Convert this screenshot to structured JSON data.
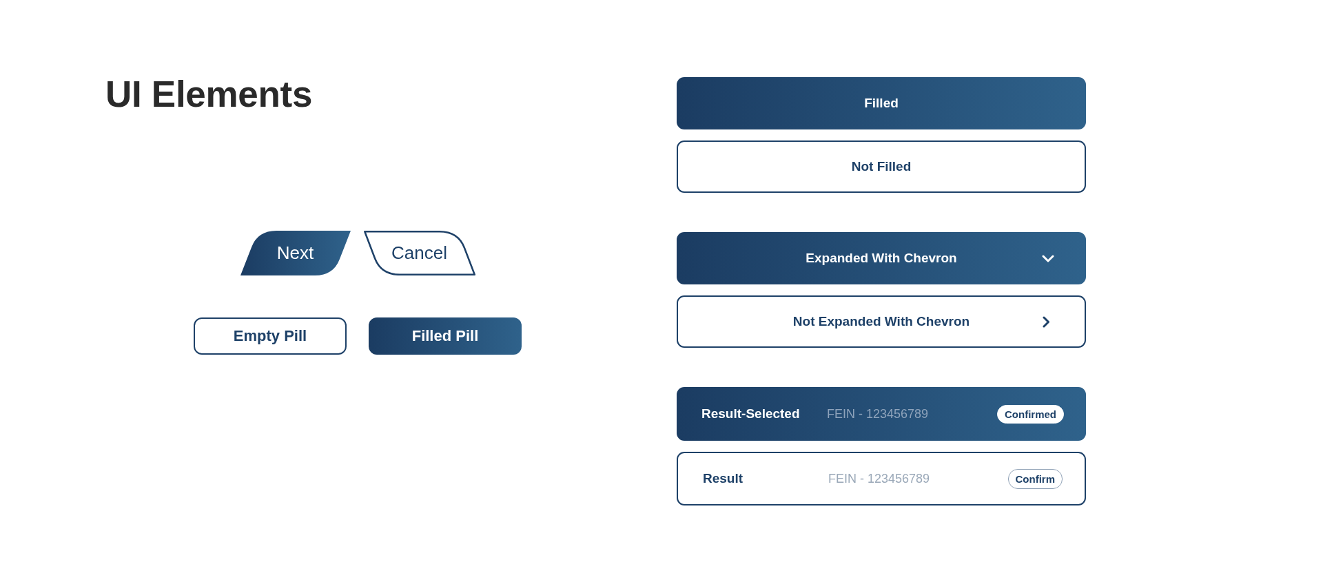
{
  "title": "UI Elements",
  "step_buttons": [
    {
      "label": "Next",
      "kind": "filled"
    },
    {
      "label": "Cancel",
      "kind": "outline"
    }
  ],
  "pills": [
    {
      "label": "Empty Pill",
      "kind": "outline"
    },
    {
      "label": "Filled Pill",
      "kind": "filled"
    }
  ],
  "groups": [
    {
      "items": [
        {
          "kind": "button",
          "label": "Filled",
          "filled": true
        },
        {
          "kind": "button",
          "label": "Not Filled",
          "filled": false
        }
      ]
    },
    {
      "items": [
        {
          "kind": "accordion",
          "label": "Expanded With Chevron",
          "expanded": true
        },
        {
          "kind": "accordion",
          "label": "Not Expanded With Chevron",
          "expanded": false
        }
      ]
    },
    {
      "items": [
        {
          "kind": "result",
          "label": "Result-Selected",
          "detail": "FEIN - 123456789",
          "badge": "Confirmed",
          "selected": true
        },
        {
          "kind": "result",
          "label": "Result",
          "detail": "FEIN - 123456789",
          "badge": "Confirm",
          "selected": false
        }
      ]
    }
  ]
}
